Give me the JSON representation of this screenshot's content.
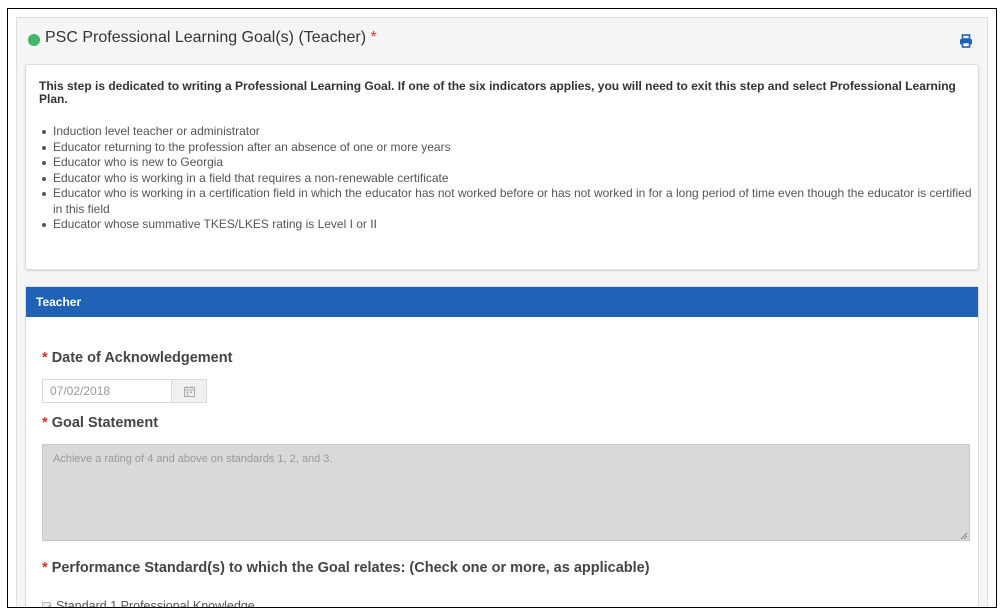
{
  "panel": {
    "title": "PSC Professional Learning Goal(s) (Teacher)",
    "required_marker": "*",
    "status_color": "#3db86b",
    "print_icon": "print-icon"
  },
  "info": {
    "intro": "This step is dedicated to writing a Professional Learning Goal. If one of the six indicators applies, you will need to exit this step and select Professional Learning Plan.",
    "indicators": [
      "Induction level teacher or administrator",
      "Educator returning to the profession after an absence of one or more years",
      "Educator who is new to Georgia",
      "Educator who is working in a field that requires a non-renewable certificate",
      "Educator who is working in a certification field in which the educator has not worked before or has not worked in for a long period of time even though the educator is certified in this field",
      "Educator whose summative TKES/LKES rating is Level I or II"
    ]
  },
  "teacher": {
    "section_title": "Teacher",
    "accent_color": "#2063b6",
    "date_label": "Date of Acknowledgement",
    "date_value": "07/02/2018",
    "goal_label": "Goal Statement",
    "goal_value": "Achieve a rating of 4 and above on standards 1, 2, and 3.",
    "standards_label": "Performance Standard(s) to which the Goal relates: (Check one or more, as applicable)",
    "standards": [
      {
        "label": "Standard 1 Professional Knowledge",
        "checked": true
      }
    ]
  }
}
